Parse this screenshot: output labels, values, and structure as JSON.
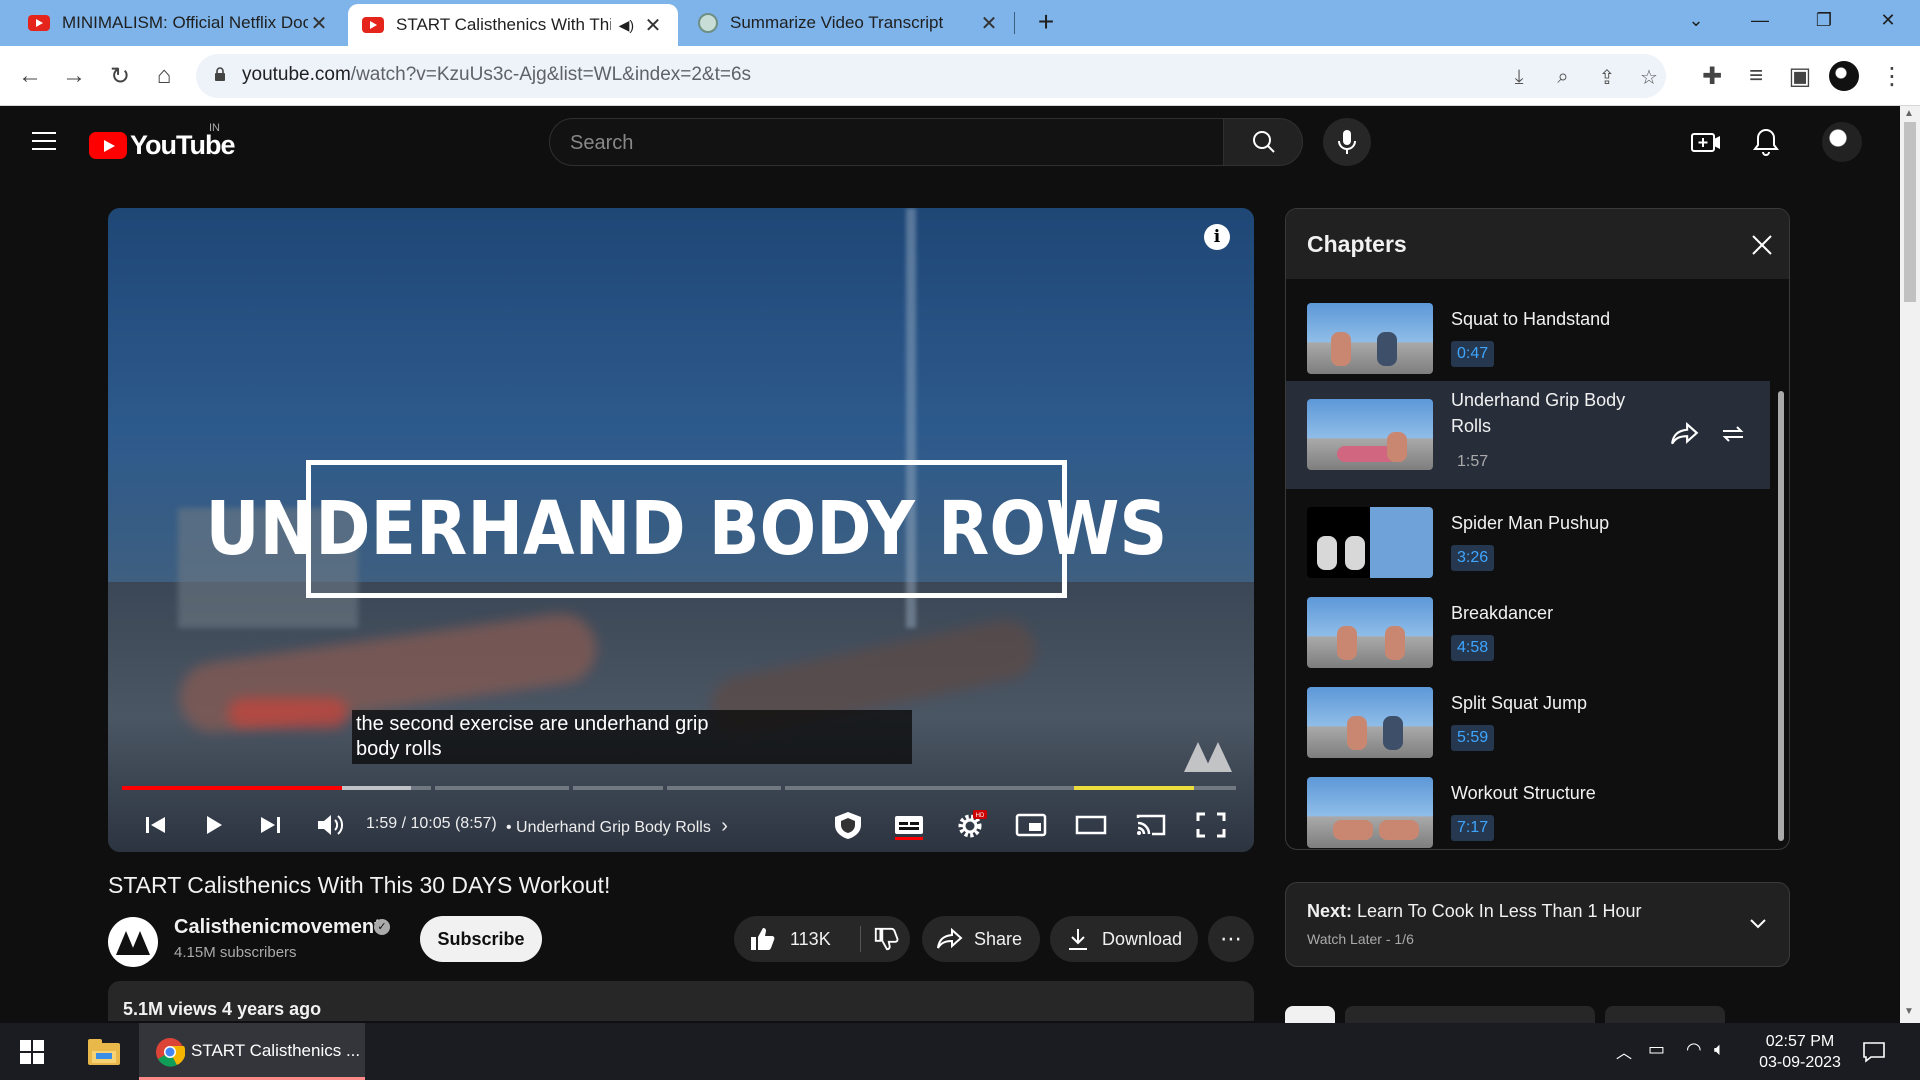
{
  "browser": {
    "tabs": [
      {
        "title": "MINIMALISM: Official Netflix Doc",
        "icon": "youtube-icon"
      },
      {
        "title": "START Calisthenics With This",
        "icon": "youtube-icon",
        "audio": "speaker-icon"
      },
      {
        "title": "Summarize Video Transcript",
        "icon": "chatgpt-icon"
      }
    ],
    "new_tab": "+",
    "url_host": "youtube.com",
    "url_rest": "/watch?v=KzuUs3c-Ajg&list=WL&index=2&t=6s"
  },
  "youtube": {
    "logo_text": "YouTube",
    "country": "IN",
    "search_placeholder": "Search"
  },
  "player": {
    "title_card": "UNDERHAND BODY ROWS",
    "caption_line1": "the second exercise are underhand grip",
    "caption_line2": "body rolls",
    "time": "1:59 / 10:05 (8:57)",
    "chapter": "• Underhand Grip Body Rolls",
    "chapter_arrow": "›",
    "progress_fraction": 0.197,
    "info": "i"
  },
  "video": {
    "title": "START Calisthenics With This 30 DAYS Workout!",
    "channel": "Calisthenicmovement",
    "subscribers": "4.15M subscribers",
    "subscribe_label": "Subscribe",
    "likes": "113K",
    "share_label": "Share",
    "download_label": "Download",
    "views_date": "5.1M views  4 years ago"
  },
  "chapters": {
    "heading": "Chapters",
    "items": [
      {
        "name": "Squat to Handstand",
        "time": "0:47"
      },
      {
        "name": "Underhand Grip Body Rolls",
        "time": "1:57"
      },
      {
        "name": "Spider Man Pushup",
        "time": "3:26"
      },
      {
        "name": "Breakdancer",
        "time": "4:58"
      },
      {
        "name": "Split Squat Jump",
        "time": "5:59"
      },
      {
        "name": "Workout Structure",
        "time": "7:17"
      }
    ]
  },
  "playlist": {
    "next_label": "Next:",
    "next_title": "Learn To Cook In Less Than 1 Hour",
    "list_info": "Watch Later - 1/6"
  },
  "taskbar": {
    "chrome_title": "START Calisthenics ...",
    "time": "02:57 PM",
    "date": "03-09-2023"
  },
  "colors": {
    "yt_red": "#ff0000",
    "accent_blue": "#3ea6ff",
    "chrome_tabstrip": "#7eb4ea"
  }
}
